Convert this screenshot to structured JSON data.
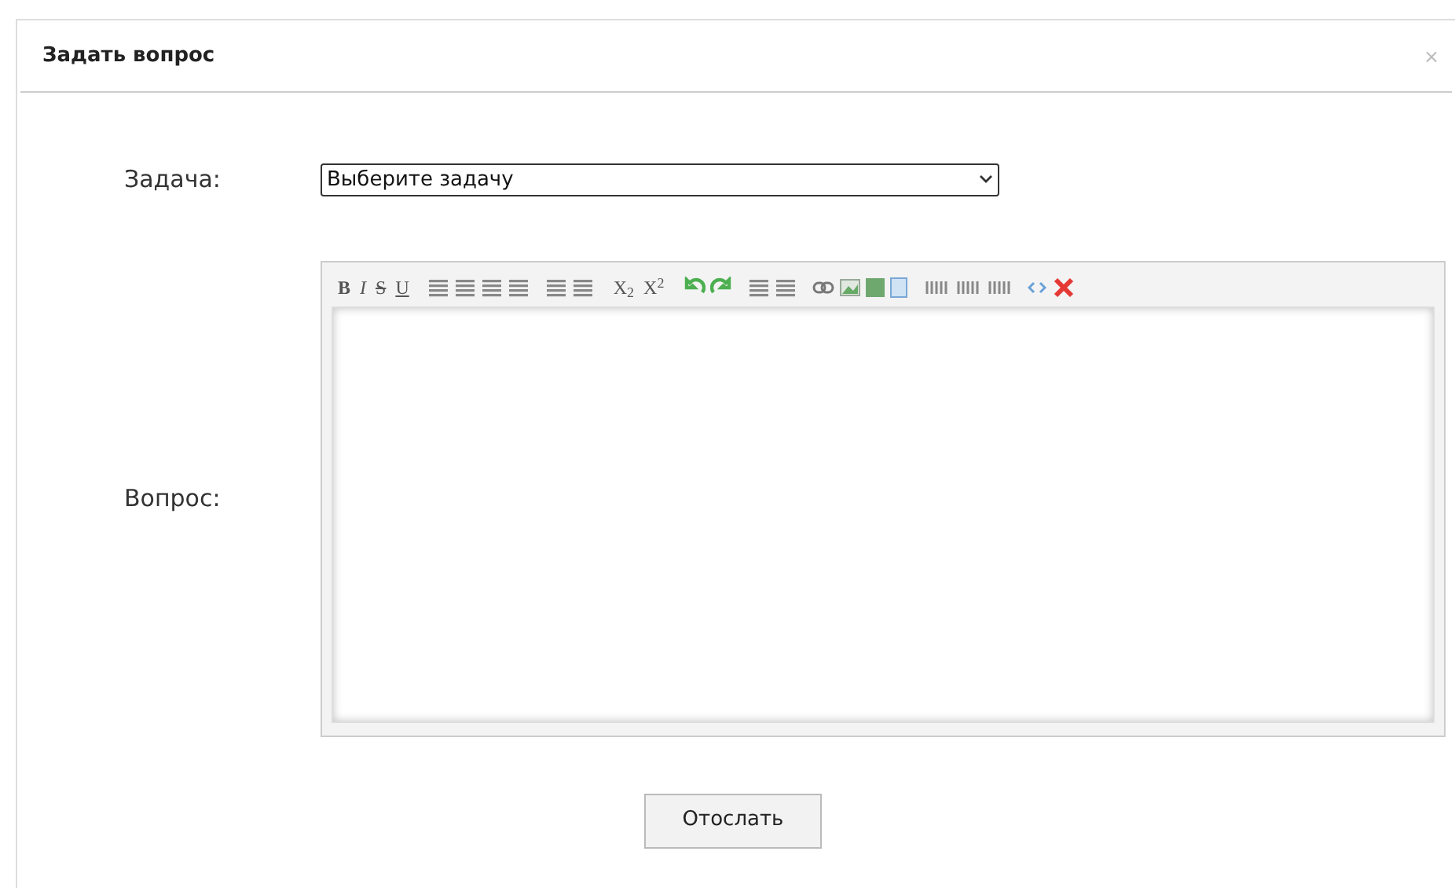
{
  "dialog": {
    "title": "Задать вопрос",
    "close": "×"
  },
  "task": {
    "label": "Задача:",
    "value": "Выберите задачу"
  },
  "question": {
    "label": "Вопрос:",
    "toolbar_text": [
      "B",
      "I",
      "S",
      "U",
      "X$_{2}$",
      "X$^{2}$"
    ]
  },
  "submit": "Отослать"
}
